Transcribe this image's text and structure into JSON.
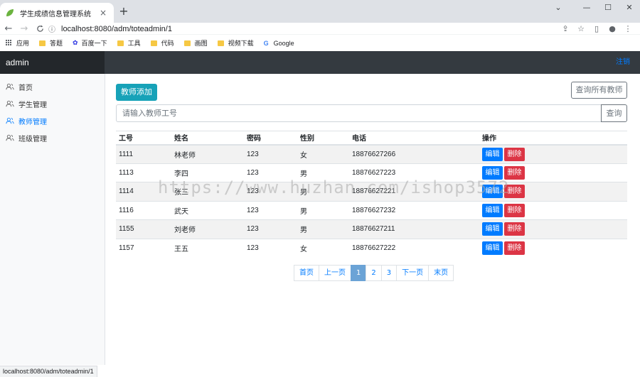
{
  "browser": {
    "tab_title": "学生成绩信息管理系统",
    "tab_close": "×",
    "new_tab": "+",
    "url": "localhost:8080/adm/toteadmin/1",
    "back": "←",
    "forward": "→",
    "reload": "C",
    "minimize": "—",
    "maximize": "☐",
    "close": "✕",
    "dropdown": "⌄",
    "bookmarks": [
      "应用",
      "答题",
      "百度一下",
      "工具",
      "代码",
      "画图",
      "视频下载",
      "Google"
    ],
    "status_url": "localhost:8080/adm/toteadmin/1"
  },
  "app": {
    "brand": "admin",
    "logout": "注销",
    "sidebar": [
      {
        "label": "首页",
        "active": false
      },
      {
        "label": "学生管理",
        "active": false
      },
      {
        "label": "教师管理",
        "active": true
      },
      {
        "label": "班级管理",
        "active": false
      }
    ],
    "add_button": "教师添加",
    "query_all_button": "查询所有教师",
    "search_placeholder": "请输入教师工号",
    "search_button": "查询",
    "table": {
      "headers": [
        "工号",
        "姓名",
        "密码",
        "性别",
        "电话",
        "操作"
      ],
      "rows": [
        [
          "1111",
          "林老师",
          "123",
          "女",
          "18876627266"
        ],
        [
          "1113",
          "李四",
          "123",
          "男",
          "18876627223"
        ],
        [
          "1114",
          "张三",
          "123",
          "男",
          "18876627221"
        ],
        [
          "1116",
          "武天",
          "123",
          "男",
          "18876627232"
        ],
        [
          "1155",
          "刘老师",
          "123",
          "男",
          "18876627211"
        ],
        [
          "1157",
          "王五",
          "123",
          "女",
          "18876627222"
        ]
      ],
      "edit_label": "编辑",
      "delete_label": "删除"
    },
    "pagination": [
      "首页",
      "上一页",
      "1",
      "2",
      "3",
      "下一页",
      "末页"
    ],
    "pagination_active": "1"
  },
  "watermark": "https://www.huzhan.com/ishop3572"
}
